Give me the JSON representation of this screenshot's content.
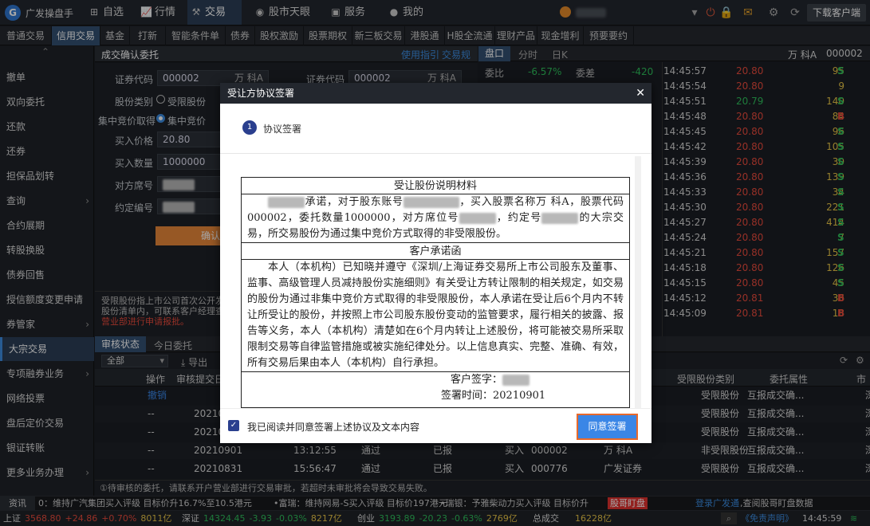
{
  "app": {
    "name": "广发操盘手",
    "download": "下载客户端",
    "time": "14:45:59"
  },
  "nav": [
    {
      "label": "自选",
      "icon": "plus-square"
    },
    {
      "label": "行情",
      "icon": "chart"
    },
    {
      "label": "交易",
      "icon": "trade"
    },
    {
      "label": "股市天眼",
      "icon": "eye"
    },
    {
      "label": "服务",
      "icon": "briefcase"
    },
    {
      "label": "我的",
      "icon": "user"
    }
  ],
  "subtabs": [
    "普通交易",
    "信用交易",
    "基金",
    "打新",
    "智能条件单",
    "债券",
    "股权激励",
    "股票期权",
    "新三板交易",
    "港股通",
    "H股全流通",
    "理财产品",
    "现金增利",
    "预要要约"
  ],
  "dakuan_badge": "4",
  "sidebar": [
    "撤单",
    "双向委托",
    "还款",
    "还券",
    "担保品划转",
    "查询",
    "合约展期",
    "转股换股",
    "债券回售",
    "授信额度变更申请",
    "券管家",
    "大宗交易",
    "专项融券业务",
    "网络投票",
    "盘后定价交易",
    "银证转账",
    "更多业务办理"
  ],
  "form": {
    "header": "成交确认委托",
    "links": [
      "使用指引",
      "交易规则"
    ],
    "code_label": "证券代码",
    "code": "000002",
    "name": "万 科A",
    "category_label": "股份类别",
    "category_opt": "受限股份",
    "obtain_label": "集中竞价取得",
    "obtain_opt": "集中竞价",
    "price_label": "买入价格",
    "price": "20.80",
    "qty_label": "买入数量",
    "qty": "1000000",
    "seat_label": "对方席号",
    "contract_label": "约定编号",
    "confirm": "确认买",
    "code2": "000002",
    "name2": "万 科A",
    "notice": [
      "受限股份指上市公司首次公开发",
      "股份清单内，可联系客户经理查",
      "营业部进行申请报批。"
    ]
  },
  "quote": {
    "tabs": [
      "盘口",
      "分时",
      "日K"
    ],
    "stock": "万 科A",
    "code": "000002",
    "lbl1": "委比",
    "val1": "-6.57%",
    "lbl2": "委差",
    "val2": "-420"
  },
  "trades": [
    {
      "t": "14:45:57",
      "p": "20.80",
      "v": "95",
      "s": "S"
    },
    {
      "t": "14:45:54",
      "p": "20.80",
      "v": "9",
      "s": ""
    },
    {
      "t": "14:45:51",
      "p": "20.79",
      "v": "140",
      "s": "S"
    },
    {
      "t": "14:45:48",
      "p": "20.80",
      "v": "84",
      "s": "B"
    },
    {
      "t": "14:45:45",
      "p": "20.80",
      "v": "96",
      "s": "S"
    },
    {
      "t": "14:45:42",
      "p": "20.80",
      "v": "105",
      "s": "S"
    },
    {
      "t": "14:45:39",
      "p": "20.80",
      "v": "30",
      "s": "S"
    },
    {
      "t": "14:45:36",
      "p": "20.80",
      "v": "139",
      "s": "S"
    },
    {
      "t": "14:45:33",
      "p": "20.80",
      "v": "34",
      "s": "S"
    },
    {
      "t": "14:45:30",
      "p": "20.80",
      "v": "221",
      "s": "S"
    },
    {
      "t": "14:45:27",
      "p": "20.80",
      "v": "414",
      "s": "S"
    },
    {
      "t": "14:45:24",
      "p": "20.80",
      "v": "7",
      "s": "S"
    },
    {
      "t": "14:45:21",
      "p": "20.80",
      "v": "157",
      "s": "S"
    },
    {
      "t": "14:45:18",
      "p": "20.80",
      "v": "126",
      "s": "S"
    },
    {
      "t": "14:45:15",
      "p": "20.80",
      "v": "45",
      "s": "S"
    },
    {
      "t": "14:45:12",
      "p": "20.81",
      "v": "36",
      "s": "B"
    },
    {
      "t": "14:45:09",
      "p": "20.81",
      "v": "18",
      "s": "B"
    }
  ],
  "grid": {
    "tabs": [
      "审核状态",
      "今日委托"
    ],
    "filter": "全部",
    "export": "导出",
    "headers": [
      "操作",
      "审核提交日",
      "受限股份类别",
      "委托属性",
      "市"
    ],
    "rows": [
      {
        "op": "撤销",
        "date": "",
        "time": "",
        "st": "",
        "rep": "",
        "side": "",
        "code": "",
        "name": "",
        "cat": "受限股份",
        "attr": "互报成交确...",
        "m": "深"
      },
      {
        "op": "--",
        "date": "20210",
        "time": "",
        "st": "",
        "rep": "",
        "side": "",
        "code": "",
        "name": "",
        "cat": "受限股份",
        "attr": "互报成交确...",
        "m": "深"
      },
      {
        "op": "--",
        "date": "20210",
        "time": "",
        "st": "",
        "rep": "",
        "side": "",
        "code": "",
        "name": "",
        "cat": "受限股份",
        "attr": "互报成交确...",
        "m": "深"
      },
      {
        "op": "--",
        "date": "20210901",
        "time": "13:12:55",
        "st": "通过",
        "rep": "已报",
        "side": "买入",
        "code": "000002",
        "name": "万 科A",
        "cat": "非受限股份",
        "attr": "互报成交确...",
        "m": "深"
      },
      {
        "op": "--",
        "date": "20210831",
        "time": "15:56:47",
        "st": "通过",
        "rep": "已报",
        "side": "买入",
        "code": "000776",
        "name": "广发证券",
        "cat": "受限股份",
        "attr": "互报成交确...",
        "m": "深"
      }
    ],
    "footer": "①待审核的委托，请联系开户营业部进行交易审批，若超时未审批将会导致交易失败。"
  },
  "dialog": {
    "title": "受让方协议签署",
    "step_num": "1",
    "step_label": "协议签署",
    "doc_title": "受让股份说明材料",
    "p1a": "承诺，对于股东账号",
    "p1b": "，买入股票名称万 科A，股票代码000002，委托数量1000000，对方席位号",
    "p1c": "，约定号",
    "p1d": "的大宗交易，所交易股份为通过集中竞价方式取得的非受限股份。",
    "doc_title2": "客户承诺函",
    "p2": "本人（本机构）已知晓并遵守《深圳/上海证券交易所上市公司股东及董事、监事、高级管理人员减持股份实施细则》有关受让方转让限制的相关规定，如交易的股份为通过非集中竞价方式取得的非受限股份，本人承诺在受让后6个月内不转让所受让的股份，并按照上市公司股东股份变动的监管要求，履行相关的披露、报告等义务，本人（本机构）清楚如在6个月内转让上述股份，将可能被交易所采取限制交易等自律监管措施或被实施纪律处分。以上信息真实、完整、准确、有效，所有交易后果由本人（本机构）自行承担。",
    "sign_label": "客户签字：",
    "time_label": "签署时间：",
    "sign_time": "20210901",
    "check_label": "我已阅读并同意签署上述协议及文本内容",
    "agree": "同意签署"
  },
  "ticker": {
    "tag": "资讯",
    "items": [
      "0：维持广汽集团买入评级 目标价升16.7%至10.5港元",
      "•富瑞：维持网易-S买入评级 目标价197港元",
      "•瑞银：予雅柴动力买入评级 目标价升"
    ],
    "promo": "股哥盯盘",
    "login": "登录广发通",
    "login2": ",查阅股哥盯盘数据"
  },
  "status": {
    "idx": [
      {
        "n": "上证",
        "v": "3568.80",
        "c": "+24.86",
        "p": "+0.70%",
        "a": "8011亿",
        "dir": "up"
      },
      {
        "n": "深证",
        "v": "14324.45",
        "c": "-3.93",
        "p": "-0.03%",
        "a": "8217亿",
        "dir": "down"
      },
      {
        "n": "创业",
        "v": "3193.89",
        "c": "-20.23",
        "p": "-0.63%",
        "a": "2769亿",
        "dir": "down"
      },
      {
        "n": "总成交",
        "v": "",
        "c": "",
        "p": "",
        "a": "16228亿",
        "dir": "flat"
      }
    ],
    "disclaimer": "《免责声明》"
  },
  "colors": {
    "up": "#e84b3c",
    "down": "#2fbf5b",
    "accent": "#3a86e6",
    "gold": "#e8c547"
  }
}
